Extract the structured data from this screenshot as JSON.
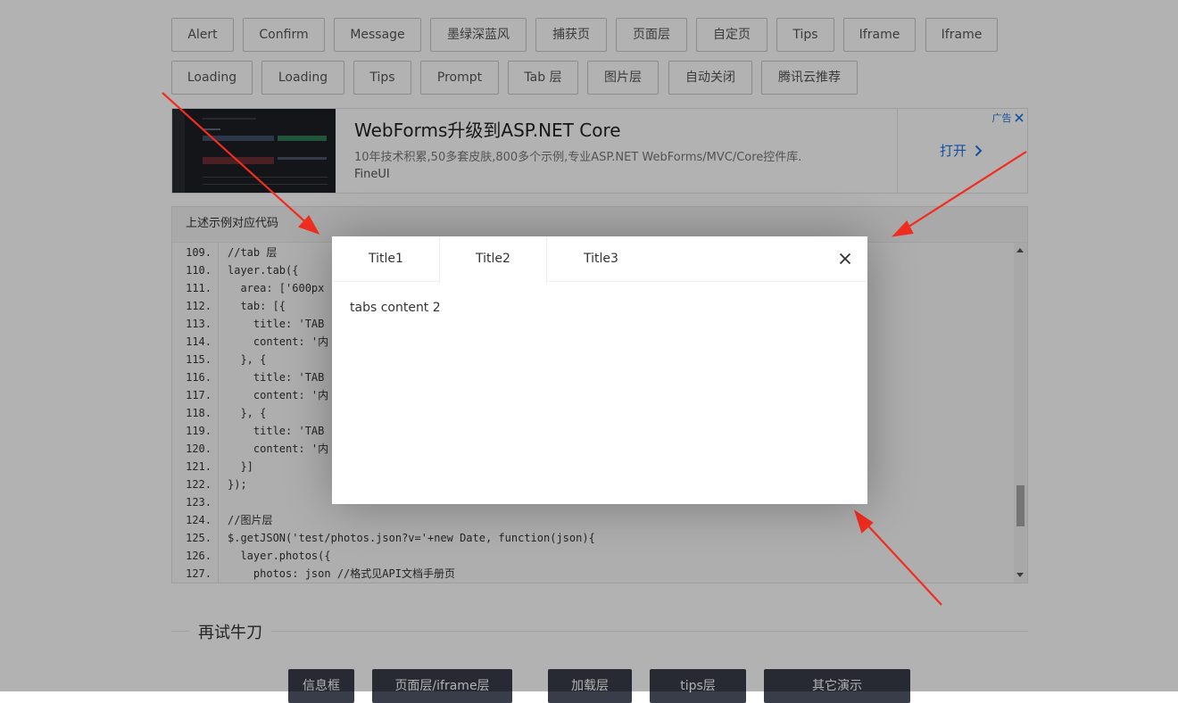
{
  "buttons_row1": [
    {
      "label": "Alert"
    },
    {
      "label": "Confirm"
    },
    {
      "label": "Message"
    },
    {
      "label": "墨绿深蓝风"
    },
    {
      "label": "捕获页"
    },
    {
      "label": "页面层"
    },
    {
      "label": "自定页"
    },
    {
      "label": "Tips"
    },
    {
      "label": "Iframe"
    },
    {
      "label": "Iframe"
    }
  ],
  "buttons_row2": [
    {
      "label": "Loading"
    },
    {
      "label": "Loading"
    },
    {
      "label": "Tips"
    },
    {
      "label": "Prompt"
    },
    {
      "label": "Tab 层"
    },
    {
      "label": "图片层"
    },
    {
      "label": "自动关闭"
    },
    {
      "label": "腾讯云推荐"
    }
  ],
  "ad": {
    "title": "WebForms升级到ASP.NET Core",
    "description": "10年技术积累,50多套皮肤,800多个示例,专业ASP.NET WebForms/MVC/Core控件库.",
    "brand": "FineUI",
    "open_label": "打开",
    "tag": "广告"
  },
  "code_panel": {
    "heading": "上述示例对应代码",
    "lines": [
      {
        "n": "109.",
        "code": "//tab 层"
      },
      {
        "n": "110.",
        "code": "layer.tab({"
      },
      {
        "n": "111.",
        "code": "  area: ['600px"
      },
      {
        "n": "112.",
        "code": "  tab: [{"
      },
      {
        "n": "113.",
        "code": "    title: 'TAB"
      },
      {
        "n": "114.",
        "code": "    content: '内"
      },
      {
        "n": "115.",
        "code": "  }, {"
      },
      {
        "n": "116.",
        "code": "    title: 'TAB"
      },
      {
        "n": "117.",
        "code": "    content: '内"
      },
      {
        "n": "118.",
        "code": "  }, {"
      },
      {
        "n": "119.",
        "code": "    title: 'TAB"
      },
      {
        "n": "120.",
        "code": "    content: '内"
      },
      {
        "n": "121.",
        "code": "  }]"
      },
      {
        "n": "122.",
        "code": "});"
      },
      {
        "n": "123.",
        "code": ""
      },
      {
        "n": "124.",
        "code": "//图片层"
      },
      {
        "n": "125.",
        "code": "$.getJSON('test/photos.json?v='+new Date, function(json){"
      },
      {
        "n": "126.",
        "code": "  layer.photos({"
      },
      {
        "n": "127.",
        "code": "    photos: json //格式见API文档手册页"
      }
    ]
  },
  "section_title": "再试牛刀",
  "bottom_buttons": [
    {
      "label": "信息框"
    },
    {
      "label": "页面层/iframe层"
    },
    {
      "label": "加载层"
    },
    {
      "label": "tips层"
    },
    {
      "label": "其它演示"
    }
  ],
  "modal": {
    "tabs": [
      {
        "label": "Title1"
      },
      {
        "label": "Title2"
      },
      {
        "label": "Title3"
      }
    ],
    "active_tab": "Title2",
    "content": "tabs content 2"
  },
  "colors": {
    "annotation_arrow": "#f22d1f",
    "dark_button": "#393d49"
  }
}
